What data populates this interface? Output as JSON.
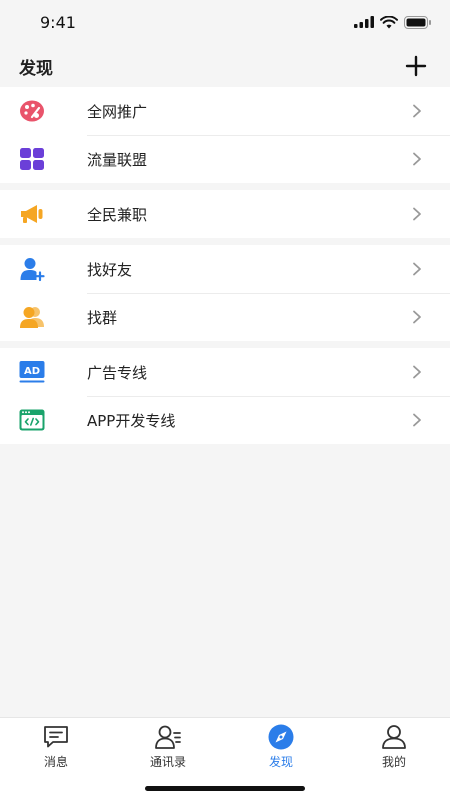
{
  "status_bar": {
    "time": "9:41"
  },
  "nav": {
    "title": "发现"
  },
  "groups": [
    {
      "items": [
        {
          "label": "全网推广",
          "icon": "palette-icon",
          "color": "#e9546b"
        },
        {
          "label": "流量联盟",
          "icon": "grid-icon",
          "color": "#6b3fd8"
        }
      ]
    },
    {
      "items": [
        {
          "label": "全民兼职",
          "icon": "megaphone-icon",
          "color": "#f5a623"
        }
      ]
    },
    {
      "items": [
        {
          "label": "找好友",
          "icon": "add-friend-icon",
          "color": "#2b7de9"
        },
        {
          "label": "找群",
          "icon": "group-icon",
          "color": "#f5a623"
        }
      ]
    },
    {
      "items": [
        {
          "label": "广告专线",
          "icon": "ad-icon",
          "color": "#2b7de9"
        },
        {
          "label": "APP开发专线",
          "icon": "code-window-icon",
          "color": "#1aa36b"
        }
      ]
    }
  ],
  "tabs": [
    {
      "label": "消息",
      "icon": "message-icon"
    },
    {
      "label": "通讯录",
      "icon": "contacts-icon"
    },
    {
      "label": "发现",
      "icon": "compass-icon",
      "active": true
    },
    {
      "label": "我的",
      "icon": "profile-icon"
    }
  ],
  "colors": {
    "accent": "#2b7de9",
    "background": "#f5f5f5"
  }
}
